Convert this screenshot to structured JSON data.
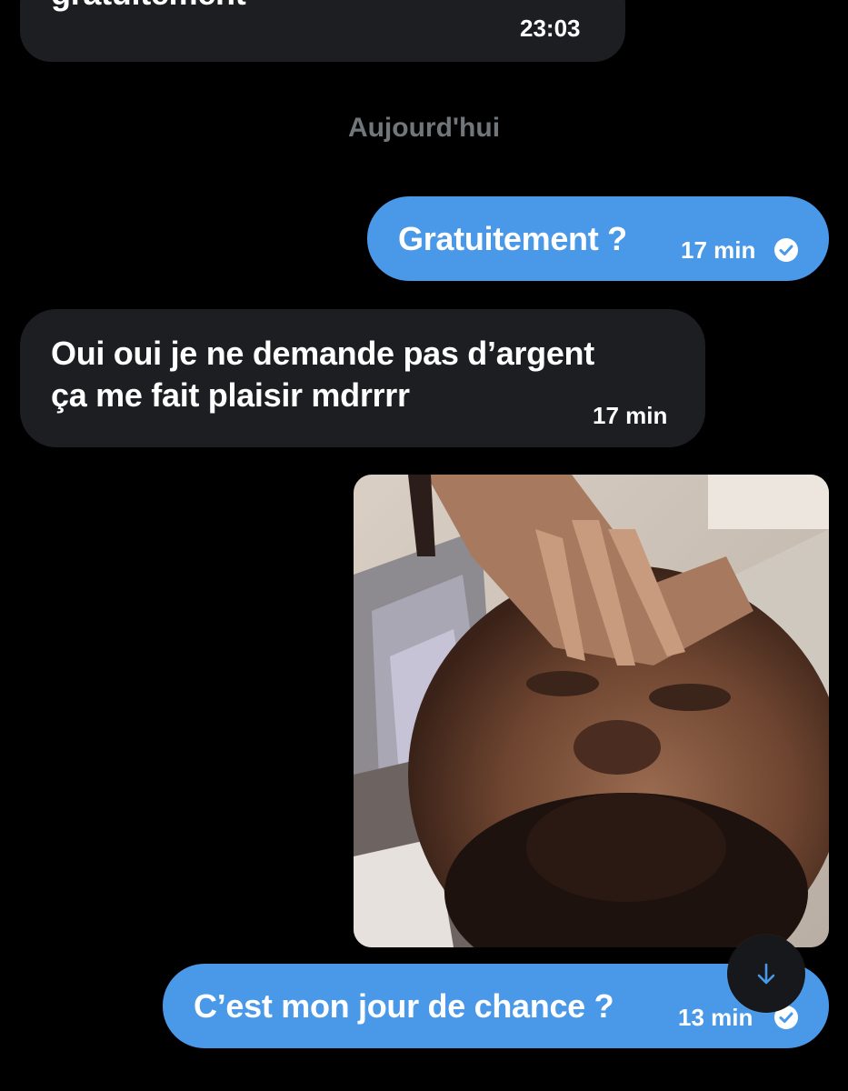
{
  "conversation": {
    "day_separator": "Aujourd'hui",
    "messages": [
      {
        "direction": "incoming",
        "lines": [
          "gratuitement"
        ],
        "time": "23:03"
      },
      {
        "direction": "outgoing",
        "lines": [
          "Gratuitement ?"
        ],
        "time": "17 min",
        "status_icon": "sent-check-icon"
      },
      {
        "direction": "incoming",
        "lines": [
          "Oui oui je ne demande pas d’argent",
          "ça me fait plaisir mdrrrr"
        ],
        "time": "17 min"
      },
      {
        "direction": "outgoing",
        "media": "reaction-gif-image"
      },
      {
        "direction": "outgoing",
        "lines": [
          "C’est mon jour de chance ?"
        ],
        "time": "13 min",
        "status_icon": "sent-check-icon"
      }
    ]
  },
  "scroll_button": {
    "icon": "arrow-down-icon"
  },
  "colors": {
    "background": "#000000",
    "incoming_bubble": "#1c1e21",
    "outgoing_bubble": "#4a99e9",
    "separator_text": "#71767b",
    "text": "#ffffff"
  }
}
